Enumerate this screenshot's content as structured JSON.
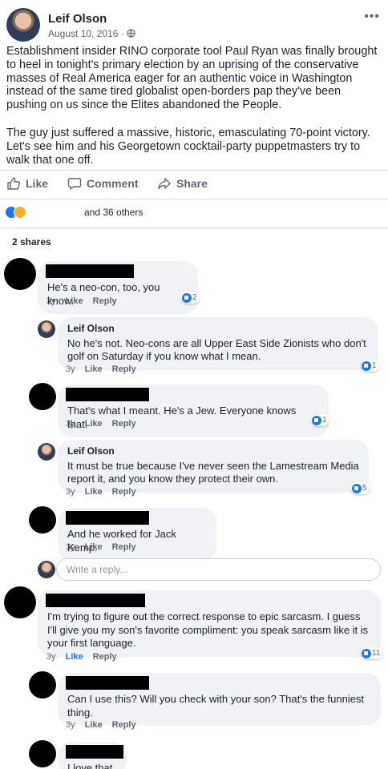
{
  "post": {
    "author": "Leif Olson",
    "date": "August 10, 2016 · ",
    "globe_icon": "globe-icon",
    "menu_icon": "more-dots-icon",
    "paragraphs": [
      "Establishment insider RINO corporate tool Paul Ryan was finally brought to heel in tonight's primary election by an uprising of the conservative masses of Real America eager for an authentic voice in Washington instead of the same tired globalist open-borders pap they've been pushing on us since the Elites abandoned the People.",
      "The guy just suffered a massive, historic, emasculating 70-point victory. Let's see him and his Georgetown cocktail-party puppetmasters try to walk that one off."
    ]
  },
  "actions": {
    "like": "Like",
    "comment": "Comment",
    "share": "Share"
  },
  "reactions": {
    "icons": [
      "like-icon",
      "haha-icon"
    ],
    "text": "and 36 others"
  },
  "shares_text": "2 shares",
  "comment_meta": {
    "like": "Like",
    "reply": "Reply"
  },
  "comments": [
    {
      "name": "",
      "text": "He's a neo-con, too, you know.",
      "age": "3y",
      "likes": "2"
    },
    {
      "name": "Leif Olson",
      "text": "No he's not. Neo-cons are all Upper East Side Zionists who don't golf on Saturday if you know what I mean.",
      "age": "3y",
      "likes": "1"
    },
    {
      "name": "",
      "text": "That's what I meant. He's a Jew. Everyone knows that.",
      "age": "3y",
      "likes": "1"
    },
    {
      "name": "Leif Olson",
      "text": "It must be true because I've never seen the Lamestream Media report it, and you know they protect their own.",
      "age": "3y",
      "likes": "5"
    },
    {
      "name": "",
      "text": "And he worked for Jack Kemp.",
      "age": "3y",
      "likes": ""
    },
    {
      "name": "",
      "text": "I'm trying to figure out the correct response to epic sarcasm. I guess I'll give you my son's favorite compliment: you speak sarcasm like it is your first language.",
      "age": "3y",
      "likes": "11"
    },
    {
      "name": "",
      "text": "Can I use this?  Will you check with your son?  That's the funniest thing.",
      "age": "3y",
      "likes": ""
    },
    {
      "name": "",
      "text": "I love that",
      "age": "",
      "likes": ""
    }
  ],
  "reply_placeholder": "Write a reply..."
}
